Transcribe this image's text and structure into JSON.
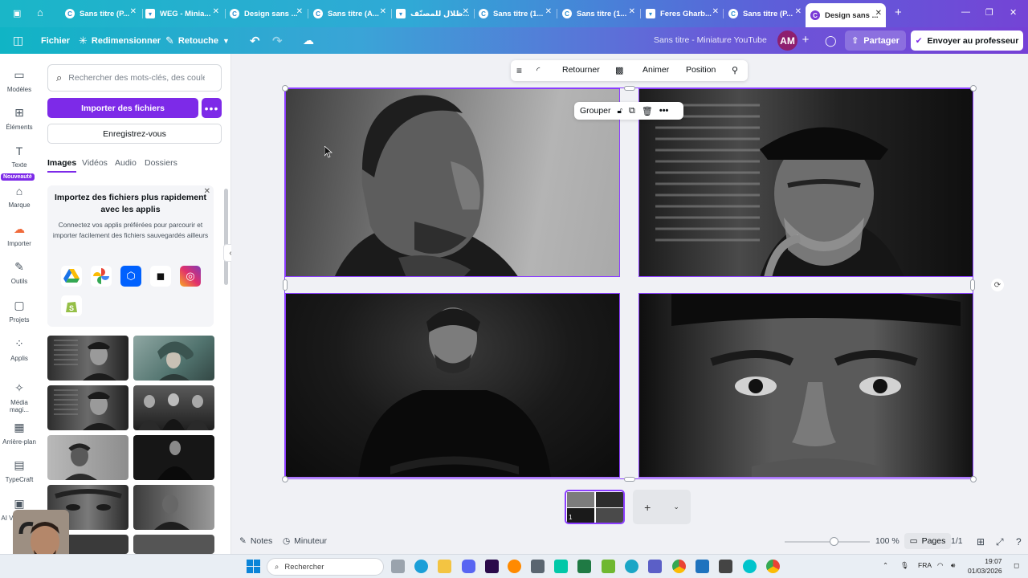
{
  "browser": {
    "tabs": [
      {
        "label": "Sans titre (P...",
        "icon": "canva-icon"
      },
      {
        "label": "WEG - Minia...",
        "icon": "bookmark-icon"
      },
      {
        "label": "Design sans ...",
        "icon": "canva-icon"
      },
      {
        "label": "Sans titre (A...",
        "icon": "canva-icon"
      },
      {
        "label": "ظلال للمصنّف...",
        "icon": "bookmark-icon"
      },
      {
        "label": "Sans titre (1...",
        "icon": "canva-icon"
      },
      {
        "label": "Sans titre (1...",
        "icon": "canva-icon"
      },
      {
        "label": "Feres Gharb...",
        "icon": "bookmark-icon"
      },
      {
        "label": "Sans titre (P...",
        "icon": "canva-icon"
      },
      {
        "label": "Design sans ...",
        "icon": "canva-icon",
        "active": true
      }
    ],
    "new_tab": "+"
  },
  "header": {
    "file": "Fichier",
    "resize": "Redimensionner",
    "retouch": "Retouche",
    "doc_title": "Sans titre - Miniature YouTube",
    "avatar_initials": "AM",
    "share": "Partager",
    "send_to_teacher": "Envoyer au professeur"
  },
  "rail": [
    {
      "label": "Modèles",
      "icon": "templates-icon"
    },
    {
      "label": "Éléments",
      "icon": "elements-icon"
    },
    {
      "label": "Texte",
      "icon": "text-icon"
    },
    {
      "label": "Marque",
      "icon": "brand-icon"
    },
    {
      "label": "Importer",
      "icon": "upload-icon"
    },
    {
      "label": "Outils",
      "icon": "tools-icon"
    },
    {
      "label": "Projets",
      "icon": "folder-icon"
    },
    {
      "label": "Applis",
      "icon": "apps-icon"
    },
    {
      "label": "Média magi...",
      "icon": "magic-media-icon"
    },
    {
      "label": "Arrière-plan",
      "icon": "background-icon"
    },
    {
      "label": "TypeCraft",
      "icon": "typecraft-icon"
    },
    {
      "label": "AI Video G...",
      "icon": "ai-video-icon"
    }
  ],
  "rail_badge": "Nouveauté",
  "panel": {
    "search_placeholder": "Rechercher des mots-clés, des couleu",
    "import_button": "Importer des fichiers",
    "more_button": "•••",
    "register_button": "Enregistrez-vous",
    "tabs": [
      "Images",
      "Vidéos",
      "Audio",
      "Dossiers"
    ],
    "active_tab": "Images",
    "promo_title": "Importez des fichiers plus rapidement avec les applis",
    "promo_text": "Connectez vos applis préférées pour parcourir et importer facilement des fichiers sauvegardés ailleurs",
    "apps": [
      "google-drive",
      "google-photos",
      "dropbox",
      "box",
      "instagram",
      "shopify"
    ]
  },
  "toolbar": {
    "flip": "Retourner",
    "animate": "Animer",
    "position": "Position"
  },
  "group_bar": {
    "group": "Grouper"
  },
  "bottom": {
    "notes": "Notes",
    "timer": "Minuteur",
    "zoom": "100 %",
    "pages": "Pages",
    "page_count": "1/1",
    "page_number": "1",
    "zoom_level": 0.55
  },
  "taskbar": {
    "search": "Rechercher",
    "lang": "FRA",
    "time": "19:07",
    "date": "01/03/2026"
  },
  "colors": {
    "accent": "#7d2ae8",
    "selection": "#8b3dff"
  }
}
